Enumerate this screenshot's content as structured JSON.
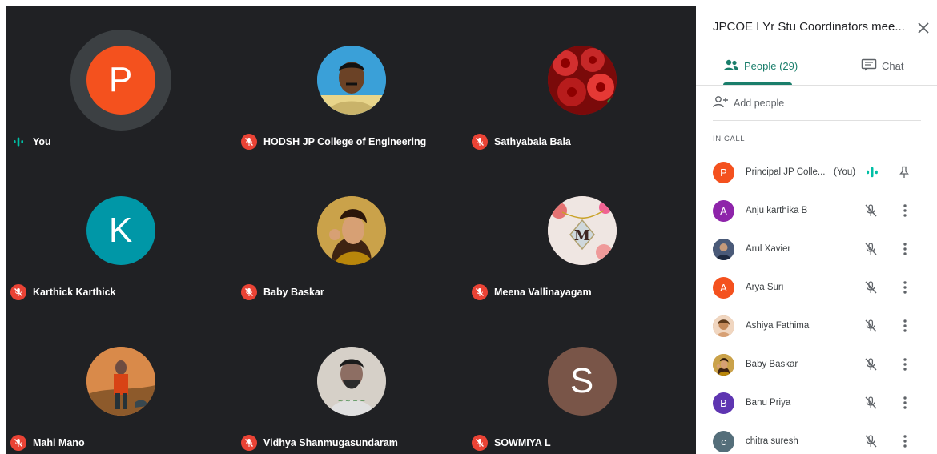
{
  "colors": {
    "grid_bg": "#202124",
    "accent": "#1a7e6b",
    "mute_red": "#ea4335",
    "speaking_green": "#00bfa5"
  },
  "tiles": [
    {
      "name": "You",
      "initial": "P",
      "avatar_color": "#f4511e",
      "status": "speaking"
    },
    {
      "name": "HODSH JP College of Engineering",
      "initial": "",
      "avatar_color": "#3aa0d8",
      "status": "muted",
      "photo": "man-blue-background"
    },
    {
      "name": "Sathyabala Bala",
      "initial": "",
      "avatar_color": "#b71c1c",
      "status": "muted",
      "photo": "red-roses"
    },
    {
      "name": "Karthick Karthick",
      "initial": "K",
      "avatar_color": "#0097a7",
      "status": "muted"
    },
    {
      "name": "Baby Baskar",
      "initial": "",
      "avatar_color": "#c7912b",
      "status": "muted",
      "photo": "woman-portrait"
    },
    {
      "name": "Meena Vallinayagam",
      "initial": "",
      "avatar_color": "#e8b4b8",
      "status": "muted",
      "photo": "letter-m-pendant"
    },
    {
      "name": "Mahi Mano",
      "initial": "",
      "avatar_color": "#d97a3a",
      "status": "muted",
      "photo": "man-outdoors"
    },
    {
      "name": "Vidhya Shanmugasundaram",
      "initial": "",
      "avatar_color": "#8c8c8c",
      "status": "muted",
      "photo": "man-with-caption"
    },
    {
      "name": "SOWMIYA L",
      "initial": "S",
      "avatar_color": "#795548",
      "status": "muted"
    }
  ],
  "panel": {
    "title": "JPCOE I Yr Stu Coordinators mee...",
    "close_icon": "close-icon",
    "tabs": [
      {
        "label": "People (29)",
        "icon": "people-icon",
        "active": true
      },
      {
        "label": "Chat",
        "icon": "chat-icon",
        "active": false
      }
    ],
    "add_people": "Add people",
    "section_label": "IN CALL",
    "participants": [
      {
        "name": "Principal JP Colle...",
        "you": "(You)",
        "initial": "P",
        "color": "#f4511e",
        "speaking": true
      },
      {
        "name": "Anju karthika B",
        "initial": "A",
        "color": "#8e24aa"
      },
      {
        "name": "Arul Xavier",
        "initial": "",
        "color": "#4a5a78",
        "photo": "man-photo"
      },
      {
        "name": "Arya Suri",
        "initial": "A",
        "color": "#f4511e"
      },
      {
        "name": "Ashiya Fathima",
        "initial": "",
        "color": "#c48a5a",
        "photo": "woman-photo"
      },
      {
        "name": "Baby Baskar",
        "initial": "",
        "color": "#c7912b",
        "photo": "woman-portrait"
      },
      {
        "name": "Banu Priya",
        "initial": "B",
        "color": "#5e35b1"
      },
      {
        "name": "chitra suresh",
        "initial": "c",
        "color": "#546e7a"
      }
    ]
  }
}
